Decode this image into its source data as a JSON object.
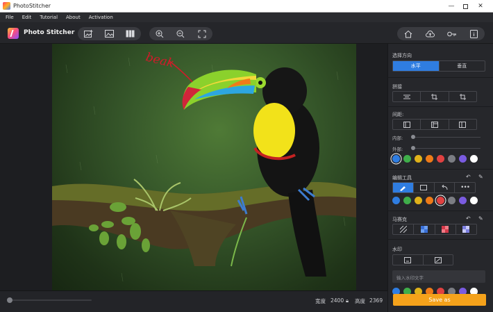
{
  "window": {
    "title": "PhotoStitcher"
  },
  "menu": [
    "File",
    "Edit",
    "Tutorial",
    "About",
    "Activation"
  ],
  "brand": {
    "name": "Photo Stitcher"
  },
  "canvas": {
    "annotation_text": "beak"
  },
  "status": {
    "width_label": "宽度",
    "width_value": "2400",
    "height_label": "高度",
    "height_value": "2369"
  },
  "panel": {
    "direction": {
      "title": "选择方向",
      "options": [
        "水平",
        "垂直"
      ],
      "selected": "水平"
    },
    "stitch": {
      "title": "拼接"
    },
    "spacing": {
      "title": "间距:",
      "inner_label": "内部:",
      "outer_label": "外部:"
    },
    "edit_tools": {
      "title": "编辑工具"
    },
    "mosaic": {
      "title": "马赛克"
    },
    "watermark": {
      "title": "水印",
      "placeholder": "输入水印文字"
    }
  },
  "colors": {
    "accent": "#2f7de1",
    "save": "#f5a21b",
    "swatches": [
      "#2f7de1",
      "#3fae4a",
      "#e0b21a",
      "#ee7b18",
      "#e04141",
      "#7b7d83",
      "#7a5be0",
      "#ffffff"
    ]
  },
  "actions": {
    "save_as": "Save as"
  }
}
